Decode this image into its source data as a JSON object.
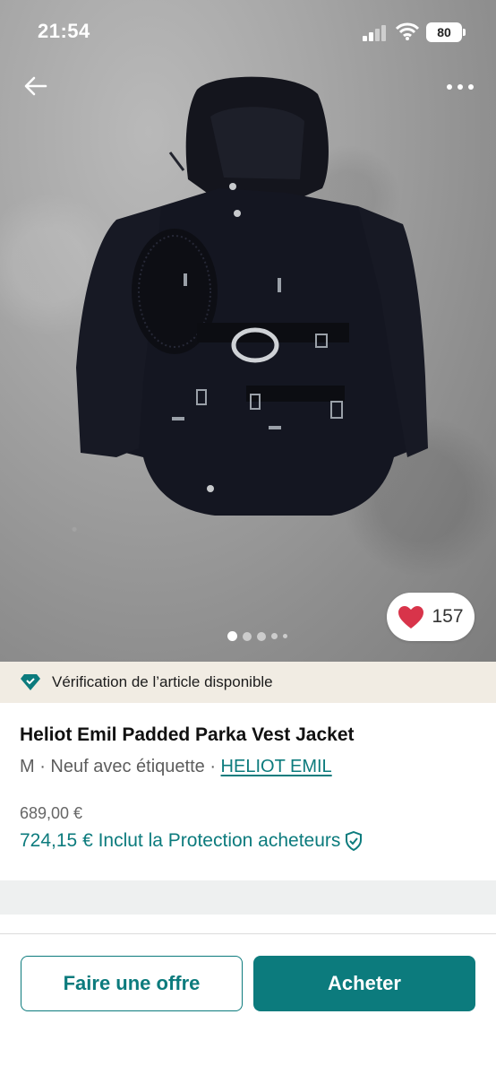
{
  "status_bar": {
    "time": "21:54",
    "battery": "80"
  },
  "photo": {
    "alt": "Heliot Emil Padded Parka Vest Jacket",
    "likes": "157",
    "carousel_pages": 5,
    "active_page": 1
  },
  "banner": {
    "text": "Vérification de l’article disponible"
  },
  "item": {
    "title": "Heliot Emil Padded Parka Vest Jacket",
    "size_condition": "M · Neuf avec étiquette · ",
    "brand": "HELIOT EMIL",
    "price": "689,00 €",
    "total_price": "724,15 € Inclut la Protection acheteurs"
  },
  "actions": {
    "offer": "Faire une offre",
    "buy": "Acheter"
  },
  "colors": {
    "accent": "#0c7b7d",
    "heart": "#d8344a",
    "banner_bg": "#f1ece3"
  },
  "icons": [
    "back-arrow-icon",
    "more-icon",
    "heart-icon",
    "verified-diamond-icon",
    "shield-check-icon"
  ]
}
